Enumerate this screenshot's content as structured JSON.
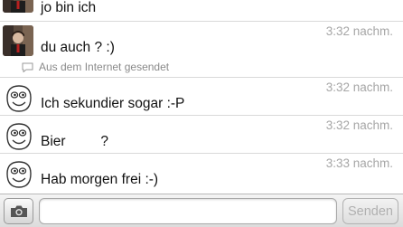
{
  "messages": [
    {
      "text": "jo bin ich",
      "time": ""
    },
    {
      "text": "du auch ? :)",
      "time": "3:32 nachm.",
      "source": "Aus dem Internet gesendet"
    },
    {
      "text": "Ich sekundier sogar :-P",
      "time": "3:32 nachm."
    },
    {
      "text": "Bier         ?",
      "time": "3:32 nachm."
    },
    {
      "text": "Hab morgen frei :-)",
      "time": "3:33 nachm."
    }
  ],
  "composer": {
    "input_value": "",
    "input_placeholder": "",
    "send_label": "Senden",
    "camera_icon": "camera-icon"
  },
  "colors": {
    "timestamp": "#a6a6a6",
    "divider": "#d9d9d9",
    "send_disabled_text": "#b0b0b0"
  }
}
